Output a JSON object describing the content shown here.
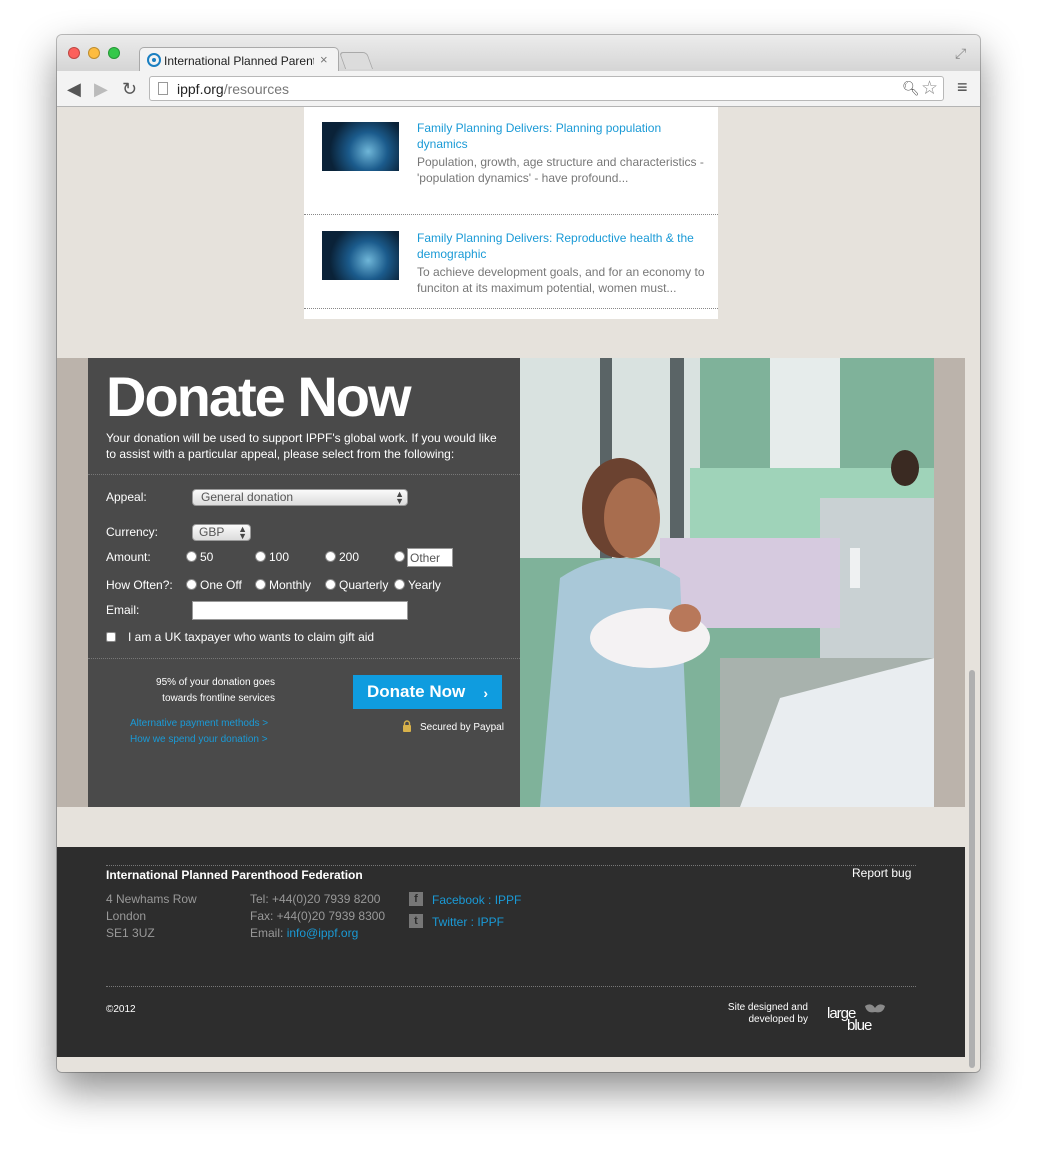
{
  "browser": {
    "tab_title": "International Planned Parenthood",
    "tab_close": "×",
    "url_host": "ippf.org",
    "url_path": "/resources"
  },
  "resources": [
    {
      "title": "Family Planning Delivers: Planning population dynamics",
      "description": "Population, growth, age structure and characteristics - 'population dynamics' - have profound..."
    },
    {
      "title": "Family Planning Delivers: Reproductive health & the demographic",
      "description": "To achieve development goals, and for an economy to funciton at its maximum potential, women must..."
    }
  ],
  "donate": {
    "heading": "Donate Now",
    "intro": "Your donation will be used to support IPPF's global work. If you would like to assist with a particular appeal, please select from the following:",
    "appeal_label": "Appeal:",
    "appeal_value": "General donation",
    "currency_label": "Currency:",
    "currency_value": "GBP",
    "amount_label": "Amount:",
    "amounts": [
      "50",
      "100",
      "200"
    ],
    "other_placeholder": "Other",
    "often_label": "How Often?:",
    "frequencies": [
      "One Off",
      "Monthly",
      "Quarterly",
      "Yearly"
    ],
    "email_label": "Email:",
    "giftaid_label": "I am a UK taxpayer who wants to claim gift aid",
    "frontline_text": "95% of your donation goes towards frontline services",
    "button_label": "Donate Now",
    "alt_payment_link": "Alternative payment methods >",
    "spend_link": "How we spend your donation >",
    "secured_text": "Secured by Paypal"
  },
  "footer": {
    "org_name": "International Planned Parenthood Federation",
    "report_bug": "Report bug",
    "address": [
      "4 Newhams Row",
      "London",
      "SE1 3UZ"
    ],
    "tel": "Tel: +44(0)20 7939 8200",
    "fax": "Fax: +44(0)20 7939 8300",
    "email_prefix": "Email: ",
    "email": "info@ippf.org",
    "facebook": "Facebook : IPPF",
    "twitter": "Twitter : IPPF",
    "copyright": "©2012",
    "credit": "Site designed and developed by",
    "logo_text_1": "large",
    "logo_text_2": "blue"
  },
  "icons": {
    "back": "back-arrow-icon",
    "forward": "forward-arrow-icon",
    "reload": "reload-icon",
    "zoom": "zoom-icon",
    "star": "bookmark-star-icon",
    "menu": "menu-icon",
    "lock": "lock-icon",
    "facebook": "facebook-icon",
    "twitter": "twitter-icon"
  },
  "colors": {
    "link_blue": "#1a9ad6",
    "donate_button": "#0f9cdf",
    "donate_panel": "#4a4a4a",
    "footer_bg": "#2d2d2d",
    "page_bg": "#e6e2dc"
  }
}
